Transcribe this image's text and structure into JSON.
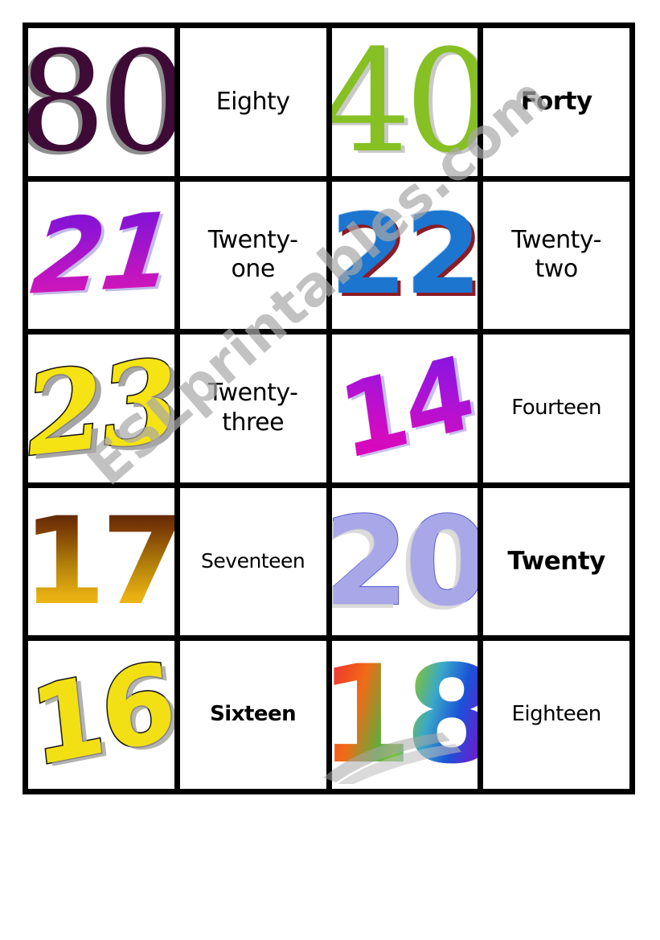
{
  "watermark": {
    "text": "ESLprintables.com",
    "color": "#a8a8a8",
    "icon": "swoosh-icon"
  },
  "grid": {
    "border_color": "#000000",
    "cell_background": "#ffffff",
    "columns": 4,
    "rows": 5,
    "cards": [
      {
        "row": 1,
        "numeral": "80",
        "word": "Eighty",
        "numeral_style": "n80",
        "word_style": "word",
        "numeral_color": "#3d0b36",
        "shadow_color": "#8e8e8e"
      },
      {
        "row": 1,
        "numeral": "40",
        "word": "Forty",
        "numeral_style": "n40",
        "word_style": "word bold",
        "numeral_color": "#86c023",
        "shadow_color": "#c9c9c9"
      },
      {
        "row": 2,
        "numeral": "21",
        "word": "Twenty-\none",
        "word_line1": "Twenty-",
        "word_line2": "one",
        "numeral_style": "n21",
        "word_style": "word",
        "numeral_color": "#9a14d0",
        "shadow_color": "#c3b8e8"
      },
      {
        "row": 2,
        "numeral": "22",
        "word_line1": "Twenty-",
        "word_line2": "two",
        "numeral_style": "n22",
        "word_style": "word",
        "numeral_color": "#1c76cf",
        "shadow_color": "#8b1c26"
      },
      {
        "row": 3,
        "numeral": "23",
        "word_line1": "Twenty-",
        "word_line2": "three",
        "numeral_style": "n23",
        "word_style": "word",
        "numeral_color": "#f5e313",
        "shadow_color": "#969696"
      },
      {
        "row": 3,
        "numeral": "14",
        "word": "Fourteen",
        "numeral_style": "n14",
        "word_style": "word small",
        "numeral_color": "#c015bf",
        "shadow_color": "#c6bdea"
      },
      {
        "row": 4,
        "numeral": "17",
        "word": "Seventeen",
        "numeral_style": "n17",
        "word_style": "word tiny",
        "numeral_color": "#b8860b",
        "shadow_color": "#f5c518"
      },
      {
        "row": 4,
        "numeral": "20",
        "word": "Twenty",
        "numeral_style": "n20",
        "word_style": "word bold",
        "numeral_color": "#a8a8e8",
        "shadow_color": "#d7d7d7"
      },
      {
        "row": 5,
        "numeral": "16",
        "word": "Sixteen",
        "numeral_style": "n16",
        "word_style": "word bold small",
        "numeral_color": "#f2e015",
        "shadow_color": "#a0a0a0"
      },
      {
        "row": 5,
        "numeral": "18",
        "word": "Eighteen",
        "numeral_style": "n18",
        "word_style": "word small",
        "numeral_color": "#f04a22",
        "shadow_color": "#c8c8c8"
      }
    ]
  },
  "cells": {
    "c1_num": "80",
    "c1_word": "Eighty",
    "c2_num": "40",
    "c2_word": "Forty",
    "c3_num": "21",
    "c3_word_a": "Twenty-",
    "c3_word_b": "one",
    "c4_num": "22",
    "c4_word_a": "Twenty-",
    "c4_word_b": "two",
    "c5_num": "23",
    "c5_word_a": "Twenty-",
    "c5_word_b": "three",
    "c6_num": "14",
    "c6_word": "Fourteen",
    "c7_num": "17",
    "c7_word": "Seventeen",
    "c8_num": "20",
    "c8_word": "Twenty",
    "c9_num": "16",
    "c9_word": "Sixteen",
    "c10_num": "18",
    "c10_word": "Eighteen"
  }
}
